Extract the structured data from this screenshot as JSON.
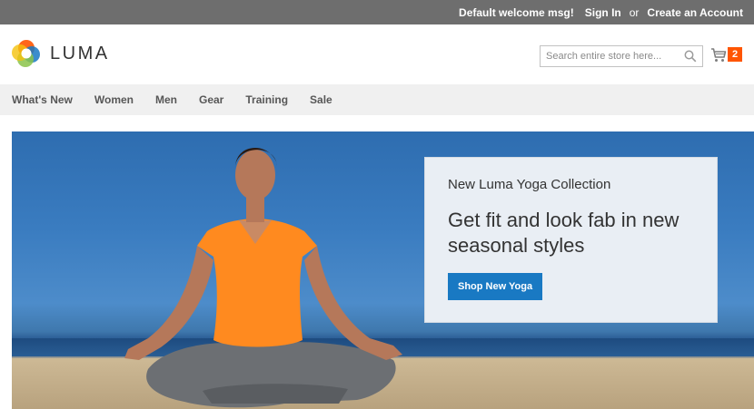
{
  "topbar": {
    "welcome": "Default welcome msg!",
    "sign_in": "Sign In",
    "or": "or",
    "create_account": "Create an Account"
  },
  "header": {
    "brand": "LUMA",
    "search_placeholder": "Search entire store here...",
    "cart_count": "2"
  },
  "nav": {
    "items": [
      "What's New",
      "Women",
      "Men",
      "Gear",
      "Training",
      "Sale"
    ]
  },
  "hero": {
    "kicker": "New Luma Yoga Collection",
    "headline": "Get fit and look fab in new seasonal styles",
    "cta": "Shop New Yoga"
  },
  "colors": {
    "topbar": "#6e6e6e",
    "nav": "#f0f0f0",
    "accent": "#1979c3",
    "cart_badge": "#ff5501"
  }
}
